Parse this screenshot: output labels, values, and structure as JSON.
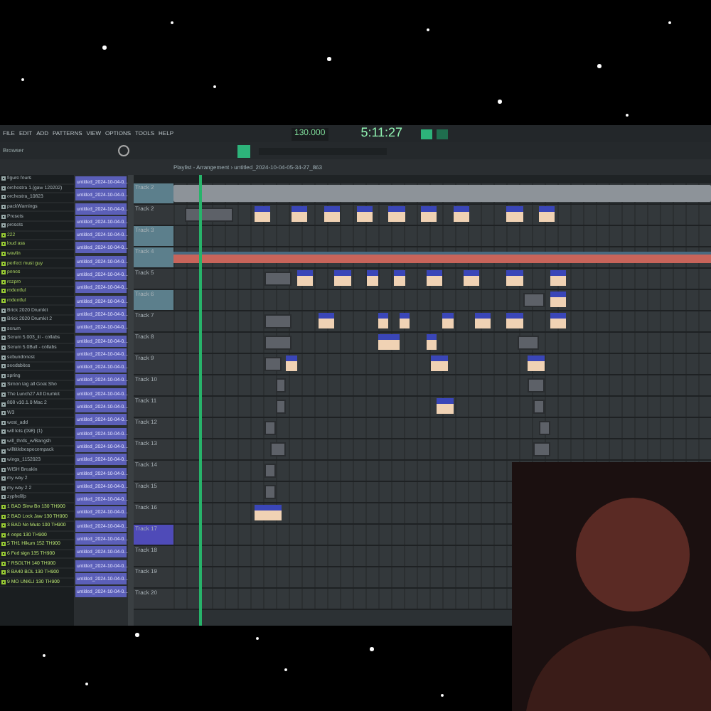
{
  "menu": [
    "FILE",
    "EDIT",
    "ADD",
    "PATTERNS",
    "VIEW",
    "OPTIONS",
    "TOOLS",
    "HELP"
  ],
  "transport": {
    "tempo": "130.000",
    "time": "5:11:27"
  },
  "playlist_title": "Playlist - Arrangement › untitled_2024-10-04-05-34-27_863",
  "browser": {
    "title": "Browser",
    "items": [
      {
        "label": "figure fours",
        "kind": "folder"
      },
      {
        "label": "orchestra 1.(gaw 120202)",
        "kind": "folder"
      },
      {
        "label": "orchestra_10823",
        "kind": "folder"
      },
      {
        "label": "packWarnings",
        "kind": "folder"
      },
      {
        "label": "Presets",
        "kind": "folder"
      },
      {
        "label": "presets",
        "kind": "folder"
      },
      {
        "label": "222",
        "kind": "file"
      },
      {
        "label": "loud ass",
        "kind": "file"
      },
      {
        "label": "wavlin",
        "kind": "file"
      },
      {
        "label": "perfect must guy",
        "kind": "file"
      },
      {
        "label": "pones",
        "kind": "file"
      },
      {
        "label": "rezpro",
        "kind": "file"
      },
      {
        "label": "rodentful",
        "kind": "file"
      },
      {
        "label": "rodentful",
        "kind": "file"
      },
      {
        "label": "Brick 2020 Drumkit",
        "kind": "folder"
      },
      {
        "label": "Brick 2020 Drumkit 2",
        "kind": "folder"
      },
      {
        "label": "serum",
        "kind": "folder"
      },
      {
        "label": "Serum 5.003_iii - collabs",
        "kind": "folder"
      },
      {
        "label": "Serum 5.0Bull - collabs",
        "kind": "folder"
      },
      {
        "label": "sebundonest",
        "kind": "folder"
      },
      {
        "label": "seedsbites",
        "kind": "folder"
      },
      {
        "label": "spring",
        "kind": "folder"
      },
      {
        "label": "Simon tag all Goat Sho",
        "kind": "folder"
      },
      {
        "label": "The Lunch27 All Drumkit",
        "kind": "folder"
      },
      {
        "label": "808 v10.1.0 Mac 2",
        "kind": "folder"
      },
      {
        "label": "W3",
        "kind": "folder"
      },
      {
        "label": "west_add",
        "kind": "folder"
      },
      {
        "label": "will lets (098) (1)",
        "kind": "folder"
      },
      {
        "label": "will_thrds_w/Bangsh",
        "kind": "folder"
      },
      {
        "label": "willtitlebespecompack",
        "kind": "folder"
      },
      {
        "label": "wings_1152023",
        "kind": "folder"
      },
      {
        "label": "WISH Breakin",
        "kind": "folder"
      },
      {
        "label": "my way 2",
        "kind": "folder"
      },
      {
        "label": "my way 2 2",
        "kind": "folder"
      },
      {
        "label": "zyphelifp",
        "kind": "folder"
      },
      {
        "label": "1 BAD Slow Bo 130 TH900",
        "kind": "sample"
      },
      {
        "label": "2 BAD Lock Jaw 130 TH900",
        "kind": "sample"
      },
      {
        "label": "3 BAD No Mute 100 TH900",
        "kind": "sample"
      },
      {
        "label": "4 oops 130 TH900",
        "kind": "sample"
      },
      {
        "label": "5 TH1 Hikum 152 TH900",
        "kind": "sample"
      },
      {
        "label": "6 Fed sign 135 TH900",
        "kind": "sample"
      },
      {
        "label": "7 RSOLTH 140 TH900",
        "kind": "sample"
      },
      {
        "label": "8 BA40 BOL 130 TH900",
        "kind": "sample"
      },
      {
        "label": "9 MO UNKLI 130 TH900",
        "kind": "sample"
      }
    ]
  },
  "patterns": [
    "untitled_2024-10-04-0...",
    "untitled_2024-10-04-0...",
    "untitled_2024-10-04-0...",
    "untitled_2024-10-04-0...",
    "untitled_2024-10-04-0...",
    "untitled_2024-10-04-0...",
    "untitled_2024-10-04-0...",
    "untitled_2024-10-04-0...",
    "untitled_2024-10-04-0...",
    "untitled_2024-10-04-0...",
    "untitled_2024-10-04-0...",
    "untitled_2024-10-04-0...",
    "untitled_2024-10-04-0...",
    "untitled_2024-10-04-0...",
    "untitled_2024-10-04-0...",
    "untitled_2024-10-04-0...",
    "untitled_2024-10-04-0...",
    "untitled_2024-10-04-0...",
    "untitled_2024-10-04-0...",
    "untitled_2024-10-04-0...",
    "untitled_2024-10-04-0...",
    "untitled_2024-10-04-0...",
    "untitled_2024-10-04-0...",
    "untitled_2024-10-04-0...",
    "untitled_2024-10-04-0...",
    "untitled_2024-10-04-0...",
    "untitled_2024-10-04-0...",
    "untitled_2024-10-04-0...",
    "untitled_2024-10-04-0...",
    "untitled_2024-10-04-0...",
    "untitled_2024-10-04-0...",
    "untitled_2024-10-04-0..."
  ],
  "tracks": [
    {
      "name": "Track 2",
      "kind": "audio",
      "selected": false
    },
    {
      "name": "Track 2",
      "kind": "pattern",
      "selected": false
    },
    {
      "name": "Track 3",
      "kind": "audio",
      "selected": false
    },
    {
      "name": "Track 4",
      "kind": "audio",
      "selected": false
    },
    {
      "name": "Track 5",
      "kind": "pattern",
      "selected": false
    },
    {
      "name": "Track 6",
      "kind": "audio",
      "selected": false
    },
    {
      "name": "Track 7",
      "kind": "pattern",
      "selected": false
    },
    {
      "name": "Track 8",
      "kind": "pattern",
      "selected": false
    },
    {
      "name": "Track 9",
      "kind": "pattern",
      "selected": false
    },
    {
      "name": "Track 10",
      "kind": "pattern",
      "selected": false
    },
    {
      "name": "Track 11",
      "kind": "pattern",
      "selected": false
    },
    {
      "name": "Track 12",
      "kind": "pattern",
      "selected": false
    },
    {
      "name": "Track 13",
      "kind": "pattern",
      "selected": false
    },
    {
      "name": "Track 14",
      "kind": "pattern",
      "selected": false
    },
    {
      "name": "Track 15",
      "kind": "pattern",
      "selected": false
    },
    {
      "name": "Track 16",
      "kind": "pattern",
      "selected": false
    },
    {
      "name": "Track 17",
      "kind": "pattern",
      "selected": true
    },
    {
      "name": "Track 18",
      "kind": "pattern",
      "selected": false
    },
    {
      "name": "Track 19",
      "kind": "pattern",
      "selected": false
    },
    {
      "name": "Track 20",
      "kind": "pattern",
      "selected": false
    }
  ]
}
